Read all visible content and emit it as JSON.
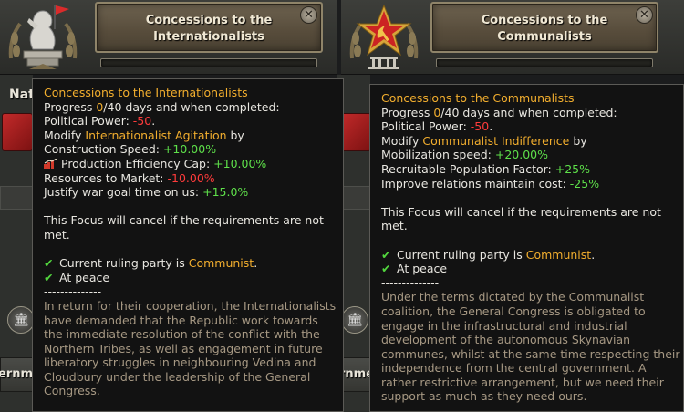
{
  "focuses": [
    {
      "title": "Concessions to the Internationalists",
      "icon": "internationalist-statue-icon",
      "close": "✕",
      "progress_fraction": 0.0
    },
    {
      "title": "Concessions to the Communalists",
      "icon": "hammer-sickle-star-icon",
      "close": "✕",
      "progress_fraction": 0.0
    }
  ],
  "background": {
    "label_left": "Nat",
    "label_left_2": "ernme",
    "label_right_2": "rnme"
  },
  "tooltips": {
    "left": {
      "title": "Concessions to the Internationalists",
      "progress_label": "Progress ",
      "progress_value": "0",
      "progress_total": "/40",
      "progress_suffix": " days and when completed:",
      "pp_label": "Political Power: ",
      "pp_value": "-50",
      "pp_end": ".",
      "modify_label": "Modify ",
      "modify_target": "Internationalist Agitation",
      "modify_suffix": " by",
      "effects": [
        {
          "label": "Construction Speed: ",
          "value": "+10.00%",
          "color": "green"
        },
        {
          "label": "Production Efficiency Cap: ",
          "value": "+10.00%",
          "color": "green",
          "icon": "production-icon"
        },
        {
          "label": "Resources to Market: ",
          "value": "-10.00%",
          "color": "red"
        },
        {
          "label": "Justify war goal time on us: ",
          "value": "+15.0%",
          "color": "green"
        }
      ],
      "cancel_1": "This Focus will cancel if the requirements are not",
      "cancel_2": "met.",
      "req1_label": "Current ruling party is ",
      "req1_value": "Communist",
      "req1_end": ".",
      "req2": "At peace",
      "divider": "--------------",
      "flavor": [
        "In return for their cooperation, the Internationalists",
        "have demanded that the Republic work towards",
        "the immediate resolution of the conflict with the",
        "Northern Tribes, as well as engagement in future",
        "liberatory struggles in neighbouring Vedina and",
        "Cloudbury under the leadership of the General",
        "Congress."
      ]
    },
    "right": {
      "title": "Concessions to the Communalists",
      "progress_label": "Progress ",
      "progress_value": "0",
      "progress_total": "/40",
      "progress_suffix": " days and when completed:",
      "pp_label": "Political Power: ",
      "pp_value": "-50",
      "pp_end": ".",
      "modify_label": "Modify ",
      "modify_target": "Communalist Indifference",
      "modify_suffix": " by",
      "effects": [
        {
          "label": "Mobilization speed: ",
          "value": "+20.00%",
          "color": "green"
        },
        {
          "label": "Recruitable Population Factor: ",
          "value": "+25%",
          "color": "green"
        },
        {
          "label": "Improve relations maintain cost: ",
          "value": "-25%",
          "color": "green"
        }
      ],
      "cancel_1": "This Focus will cancel if the requirements are not",
      "cancel_2": "met.",
      "req1_label": "Current ruling party is ",
      "req1_value": "Communist",
      "req1_end": ".",
      "req2": "At peace",
      "divider": "--------------",
      "flavor": [
        "Under the terms dictated by the Communalist",
        "coalition, the General Congress is obligated to",
        "engage in the infrastructural and industrial",
        "development of the autonomous Skynavian",
        "communes, whilst at the same time respecting their",
        "independence from the central government. A",
        "rather restrictive arrangement, but we need their",
        "support as much as they need ours."
      ]
    }
  }
}
